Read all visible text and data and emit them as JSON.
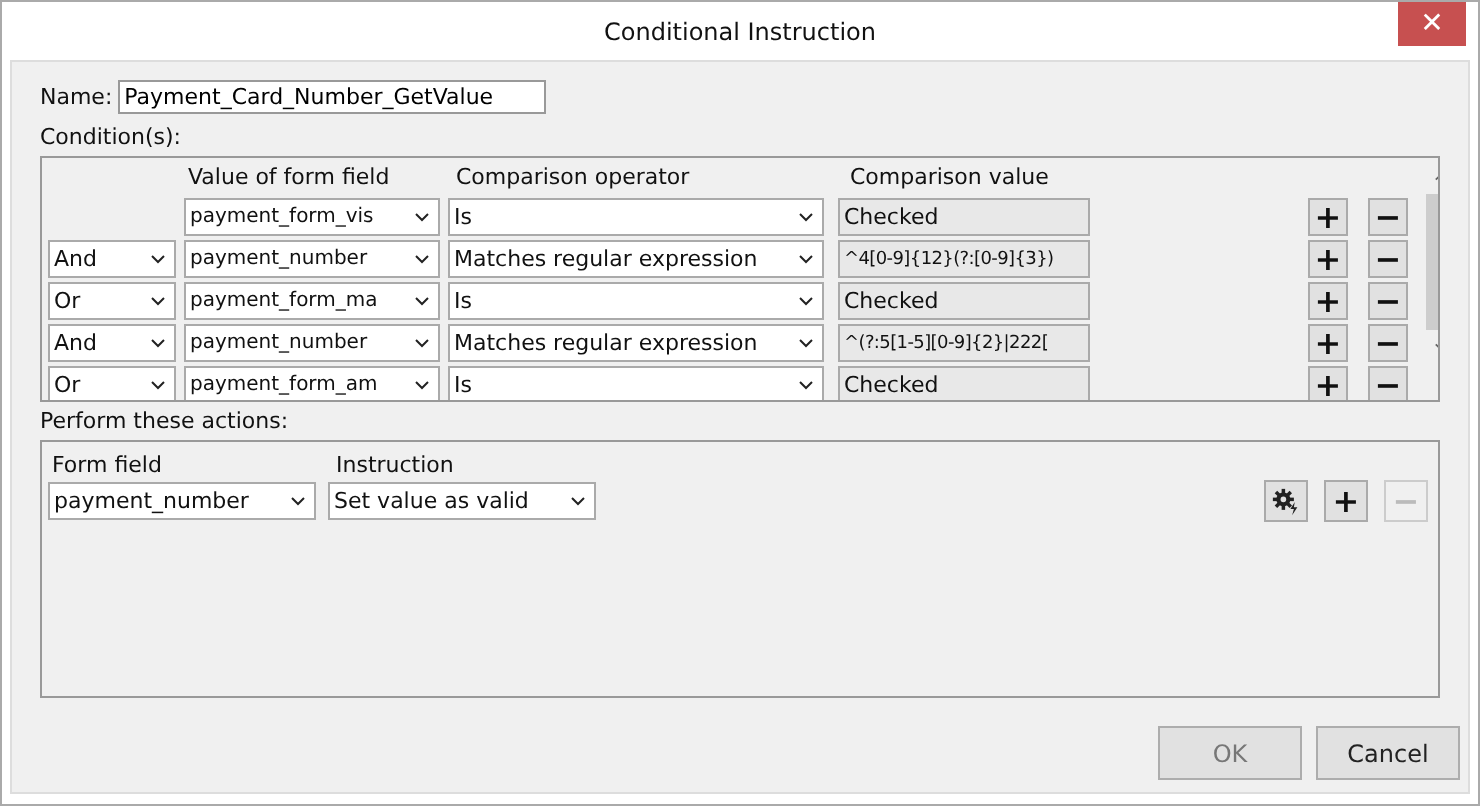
{
  "window": {
    "title": "Conditional Instruction",
    "close": "✕"
  },
  "name": {
    "label": "Name:",
    "value": "Payment_Card_Number_GetValue"
  },
  "conditions": {
    "label": "Condition(s):",
    "columns": [
      "Value of form field",
      "Comparison operator",
      "Comparison value"
    ],
    "add": "+",
    "remove": "−",
    "rows": [
      {
        "connector": null,
        "field": "payment_form_vis",
        "operator": "Is",
        "value": "Checked"
      },
      {
        "connector": "And",
        "field": "payment_number",
        "operator": "Matches regular expression",
        "value": "^4[0-9]{12}(?:[0-9]{3})"
      },
      {
        "connector": "Or",
        "field": "payment_form_ma",
        "operator": "Is",
        "value": "Checked"
      },
      {
        "connector": "And",
        "field": "payment_number",
        "operator": "Matches regular expression",
        "value": "^(?:5[1-5][0-9]{2}|222["
      },
      {
        "connector": "Or",
        "field": "payment_form_am",
        "operator": "Is",
        "value": "Checked"
      }
    ]
  },
  "actions": {
    "label": "Perform these actions:",
    "columns": [
      "Form field",
      "Instruction"
    ],
    "rows": [
      {
        "field": "payment_number",
        "instruction": "Set value as valid"
      }
    ],
    "add": {
      "text": "+",
      "disabled": false
    },
    "remove": {
      "text": "−",
      "disabled": true
    }
  },
  "buttons": [
    {
      "label": "OK",
      "disabled": true
    },
    {
      "label": "Cancel",
      "disabled": false
    }
  ]
}
